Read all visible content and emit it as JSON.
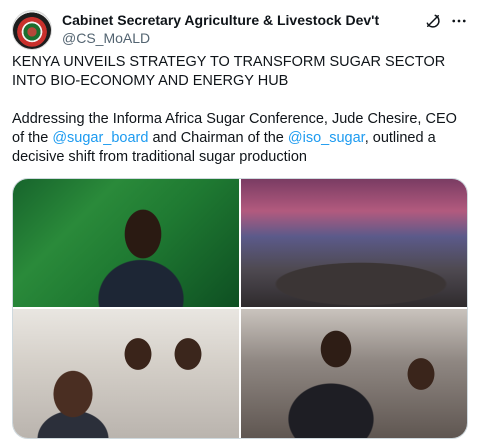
{
  "tweet": {
    "author": {
      "display_name": "Cabinet Secretary Agriculture & Livestock Dev't",
      "handle": "@CS_MoALD"
    },
    "text": {
      "headline": "KENYA UNVEILS STRATEGY TO TRANSFORM SUGAR SECTOR INTO BIO-ECONOMY AND ENERGY HUB",
      "body_before": "Addressing the Informa Africa Sugar Conference, Jude Chesire, CEO of the ",
      "mention_1": "@sugar_board",
      "body_middle": " and Chairman of the ",
      "mention_2": "@iso_sugar",
      "body_after": ", outlined a decisive shift from traditional sugar production"
    },
    "media": [
      {
        "icon": "photo-speaker-at-podium"
      },
      {
        "icon": "photo-conference-hall-audience"
      },
      {
        "icon": "photo-seated-delegates"
      },
      {
        "icon": "photo-delegates-greeting"
      }
    ]
  },
  "icons": {
    "grok": "grok-icon",
    "more": "more-options-icon",
    "avatar": "avatar"
  },
  "colors": {
    "text": "#0f1419",
    "secondary": "#536471",
    "link": "#1d9bf0",
    "border": "#cfd9de"
  }
}
